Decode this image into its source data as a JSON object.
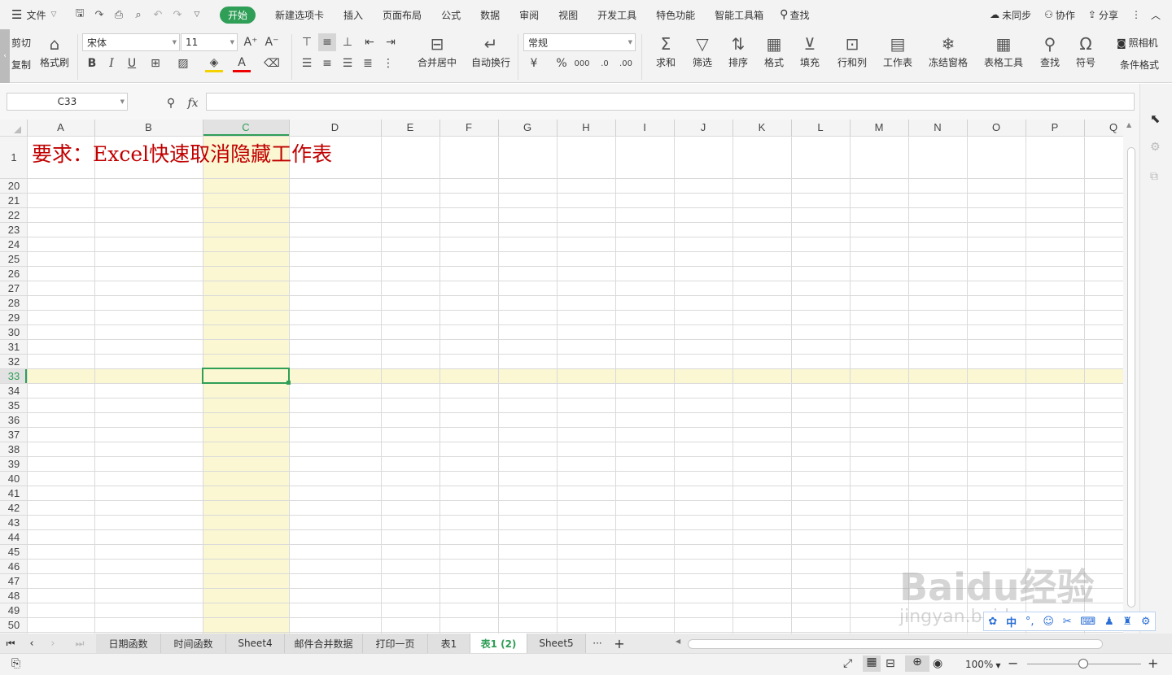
{
  "menubar": {
    "file_label": "文件",
    "tabs": [
      {
        "label": "开始",
        "active": true
      },
      {
        "label": "新建选项卡"
      },
      {
        "label": "插入"
      },
      {
        "label": "页面布局"
      },
      {
        "label": "公式"
      },
      {
        "label": "数据"
      },
      {
        "label": "审阅"
      },
      {
        "label": "视图"
      },
      {
        "label": "开发工具"
      },
      {
        "label": "特色功能"
      },
      {
        "label": "智能工具箱"
      }
    ],
    "search_label": "查找",
    "sync_label": "未同步",
    "collab_label": "协作",
    "share_label": "分享"
  },
  "ribbon": {
    "cut": "剪切",
    "copy": "复制",
    "format_painter": "格式刷",
    "font_name": "宋体",
    "font_size": "11",
    "merge_center": "合并居中",
    "wrap_text": "自动换行",
    "number_format": "常规",
    "sum": "求和",
    "filter": "筛选",
    "sort": "排序",
    "format": "格式",
    "fill": "填充",
    "rows_cols": "行和列",
    "worksheet": "工作表",
    "freeze": "冻结窗格",
    "table_tools": "表格工具",
    "find": "查找",
    "symbol": "符号",
    "camera": "照相机",
    "cond_format": "条件格式"
  },
  "formula_bar": {
    "cell_ref": "C33",
    "fx": "fx",
    "formula": ""
  },
  "sheet": {
    "columns": [
      "A",
      "B",
      "C",
      "D",
      "E",
      "F",
      "G",
      "H",
      "I",
      "J",
      "K",
      "L",
      "M",
      "N",
      "O",
      "P",
      "Q"
    ],
    "rows": [
      "1",
      "20",
      "21",
      "22",
      "23",
      "24",
      "25",
      "26",
      "27",
      "28",
      "29",
      "30",
      "31",
      "32",
      "33",
      "34",
      "35",
      "36",
      "37",
      "38",
      "39",
      "40",
      "41",
      "42",
      "43",
      "44",
      "45",
      "46",
      "47",
      "48",
      "49",
      "50"
    ],
    "selected_col": "C",
    "selected_row": "33",
    "a1_text": "要求：Excel快速取消隐藏工作表",
    "a1_color": "#c00000",
    "highlight_color": "#faf7d2",
    "selection_color": "#2f9e56"
  },
  "sheet_tabs": {
    "tabs": [
      {
        "label": "日期函数"
      },
      {
        "label": "时间函数"
      },
      {
        "label": "Sheet4"
      },
      {
        "label": "邮件合并数据"
      },
      {
        "label": "打印一页"
      },
      {
        "label": "表1"
      },
      {
        "label": "表1 (2)",
        "active": true
      },
      {
        "label": "Sheet5"
      }
    ],
    "more": "···",
    "add": "+"
  },
  "status": {
    "zoom": "100%"
  },
  "watermark": {
    "text1": "Baidu经验",
    "text2": "jingyan.baidu.com",
    "ime": "中"
  },
  "colors": {
    "accent": "#2f9e56",
    "title_red": "#c00000",
    "highlight": "#faf7d2"
  }
}
